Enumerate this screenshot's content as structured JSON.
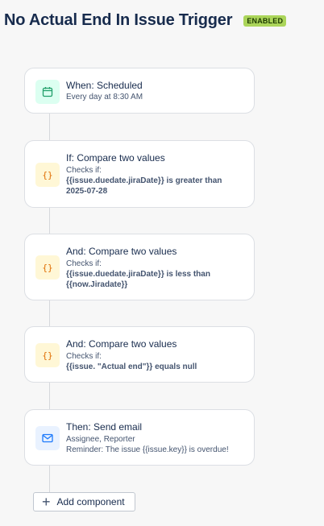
{
  "header": {
    "title": "No Actual End In Issue Trigger",
    "status": "ENABLED"
  },
  "components": [
    {
      "title": "When: Scheduled",
      "line1": "Every day at 8:30 AM",
      "icon": "calendar-icon"
    },
    {
      "title": "If: Compare two values",
      "line1": "Checks if:",
      "line2": "{{issue.duedate.jiraDate}} is greater than",
      "line3": "2025-07-28",
      "icon": "braces-icon"
    },
    {
      "title": "And: Compare two values",
      "line1": "Checks if:",
      "line2": "{{issue.duedate.jiraDate}} is less than",
      "line3": "{{now.Jiradate}}",
      "icon": "braces-icon"
    },
    {
      "title": "And: Compare two values",
      "line1": "Checks if:",
      "line2": "{{issue. \"Actual end\"}} equals null",
      "icon": "braces-icon"
    },
    {
      "title": "Then: Send email",
      "line1": "Assignee, Reporter",
      "line2": "Reminder: The issue {{issue.key}} is overdue!",
      "icon": "mail-icon"
    }
  ],
  "add_component": {
    "label": "Add component",
    "icon": "plus-icon"
  },
  "colors": {
    "badge": "#abd55a",
    "trigger_icon_bg": "#dcfff1",
    "condition_icon_bg": "#fff7d6",
    "action_icon_bg": "#e9f2ff"
  }
}
